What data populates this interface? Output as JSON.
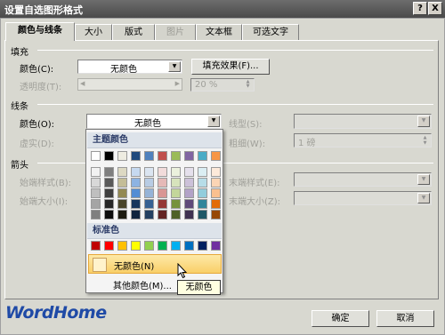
{
  "window": {
    "title": "设置自选图形格式",
    "help_btn": "?",
    "close_btn": "X"
  },
  "tabs": [
    {
      "label": "颜色与线条",
      "active": true
    },
    {
      "label": "大小"
    },
    {
      "label": "版式"
    },
    {
      "label": "图片",
      "disabled": true
    },
    {
      "label": "文本框"
    },
    {
      "label": "可选文字"
    }
  ],
  "fill": {
    "section": "填充",
    "color_label": "颜色(C):",
    "color_value": "无颜色",
    "effects_button": "填充效果(F)...",
    "transparency_label": "透明度(T):",
    "transparency_value": "20 %"
  },
  "line": {
    "section": "线条",
    "color_label": "颜色(O):",
    "color_value": "无颜色",
    "dash_label": "虚实(D):",
    "style_label": "线型(S):",
    "weight_label": "粗细(W):",
    "weight_value": "1 磅"
  },
  "arrows": {
    "section": "箭头",
    "begin_style_label": "始端样式(B):",
    "begin_size_label": "始端大小(I):",
    "end_style_label": "末端样式(E):",
    "end_size_label": "末端大小(Z):"
  },
  "color_popup": {
    "theme_header": "主题颜色",
    "standard_header": "标准色",
    "no_color": "无颜色(N)",
    "more_colors": "其他颜色(M)...",
    "tooltip": "无颜色",
    "theme_top": [
      "#ffffff",
      "#000000",
      "#eeece1",
      "#1f497d",
      "#4f81bd",
      "#c0504d",
      "#9bbb59",
      "#8064a2",
      "#4bacc6",
      "#f79646"
    ],
    "theme_shades": [
      [
        "#f2f2f2",
        "#7f7f7f",
        "#ddd9c3",
        "#c6d9f0",
        "#dbe5f1",
        "#f2dcdb",
        "#ebf1dd",
        "#e5e0ec",
        "#dbeef3",
        "#fdeada"
      ],
      [
        "#d8d8d8",
        "#595959",
        "#c4bd97",
        "#8db3e2",
        "#b8cce4",
        "#e5b9b7",
        "#d7e3bc",
        "#ccc1d9",
        "#b7dde8",
        "#fbd5b5"
      ],
      [
        "#bfbfbf",
        "#3f3f3f",
        "#938953",
        "#548dd4",
        "#95b3d7",
        "#d99694",
        "#c3d69b",
        "#b2a2c7",
        "#92cddc",
        "#fac08f"
      ],
      [
        "#a5a5a5",
        "#262626",
        "#494429",
        "#17365d",
        "#366092",
        "#953734",
        "#76923c",
        "#5f497a",
        "#31859b",
        "#e36c09"
      ],
      [
        "#7f7f7f",
        "#0c0c0c",
        "#1d1b10",
        "#0f243e",
        "#244061",
        "#632423",
        "#4f6128",
        "#3f3151",
        "#205867",
        "#974806"
      ]
    ],
    "standard": [
      "#c00000",
      "#ff0000",
      "#ffc000",
      "#ffff00",
      "#92d050",
      "#00b050",
      "#00b0f0",
      "#0070c0",
      "#002060",
      "#7030a0"
    ]
  },
  "footer": {
    "logo": "WordHome",
    "ok": "确定",
    "cancel": "取消"
  }
}
